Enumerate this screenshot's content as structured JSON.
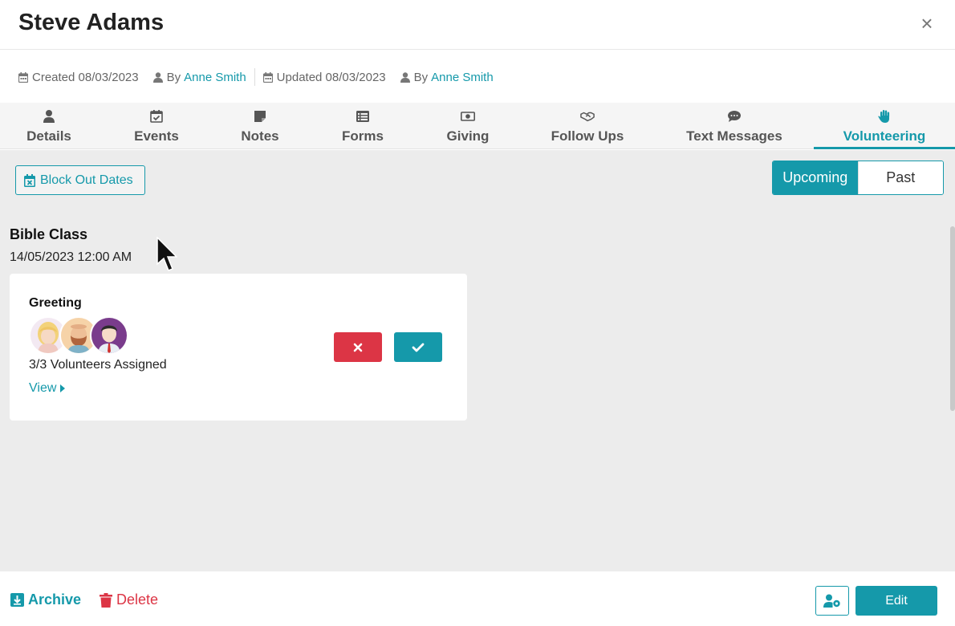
{
  "header": {
    "title": "Steve Adams",
    "close_label": "×"
  },
  "meta": {
    "created_label": "Created 08/03/2023",
    "created_by_prefix": "By",
    "created_by_name": "Anne Smith",
    "updated_label": "Updated 08/03/2023",
    "updated_by_prefix": "By",
    "updated_by_name": "Anne Smith"
  },
  "tabs": [
    {
      "label": "Details",
      "icon": "user-icon"
    },
    {
      "label": "Events",
      "icon": "calendar-check-icon"
    },
    {
      "label": "Notes",
      "icon": "sticky-note-icon"
    },
    {
      "label": "Forms",
      "icon": "list-icon"
    },
    {
      "label": "Giving",
      "icon": "money-bill-icon"
    },
    {
      "label": "Follow Ups",
      "icon": "handshake-icon"
    },
    {
      "label": "Text Messages",
      "icon": "comment-icon"
    },
    {
      "label": "Volunteering",
      "icon": "hand-icon",
      "active": true
    }
  ],
  "toolbar": {
    "block_out_label": "Block Out Dates",
    "upcoming_label": "Upcoming",
    "past_label": "Past"
  },
  "event": {
    "title": "Bible Class",
    "date": "14/05/2023 12:00 AM",
    "role": "Greeting",
    "assigned": "3/3 Volunteers Assigned",
    "view_label": "View"
  },
  "footer": {
    "archive_label": "Archive",
    "delete_label": "Delete",
    "edit_label": "Edit"
  },
  "colors": {
    "accent": "#1599aa",
    "danger": "#dc3545",
    "content_bg": "#ececec"
  }
}
